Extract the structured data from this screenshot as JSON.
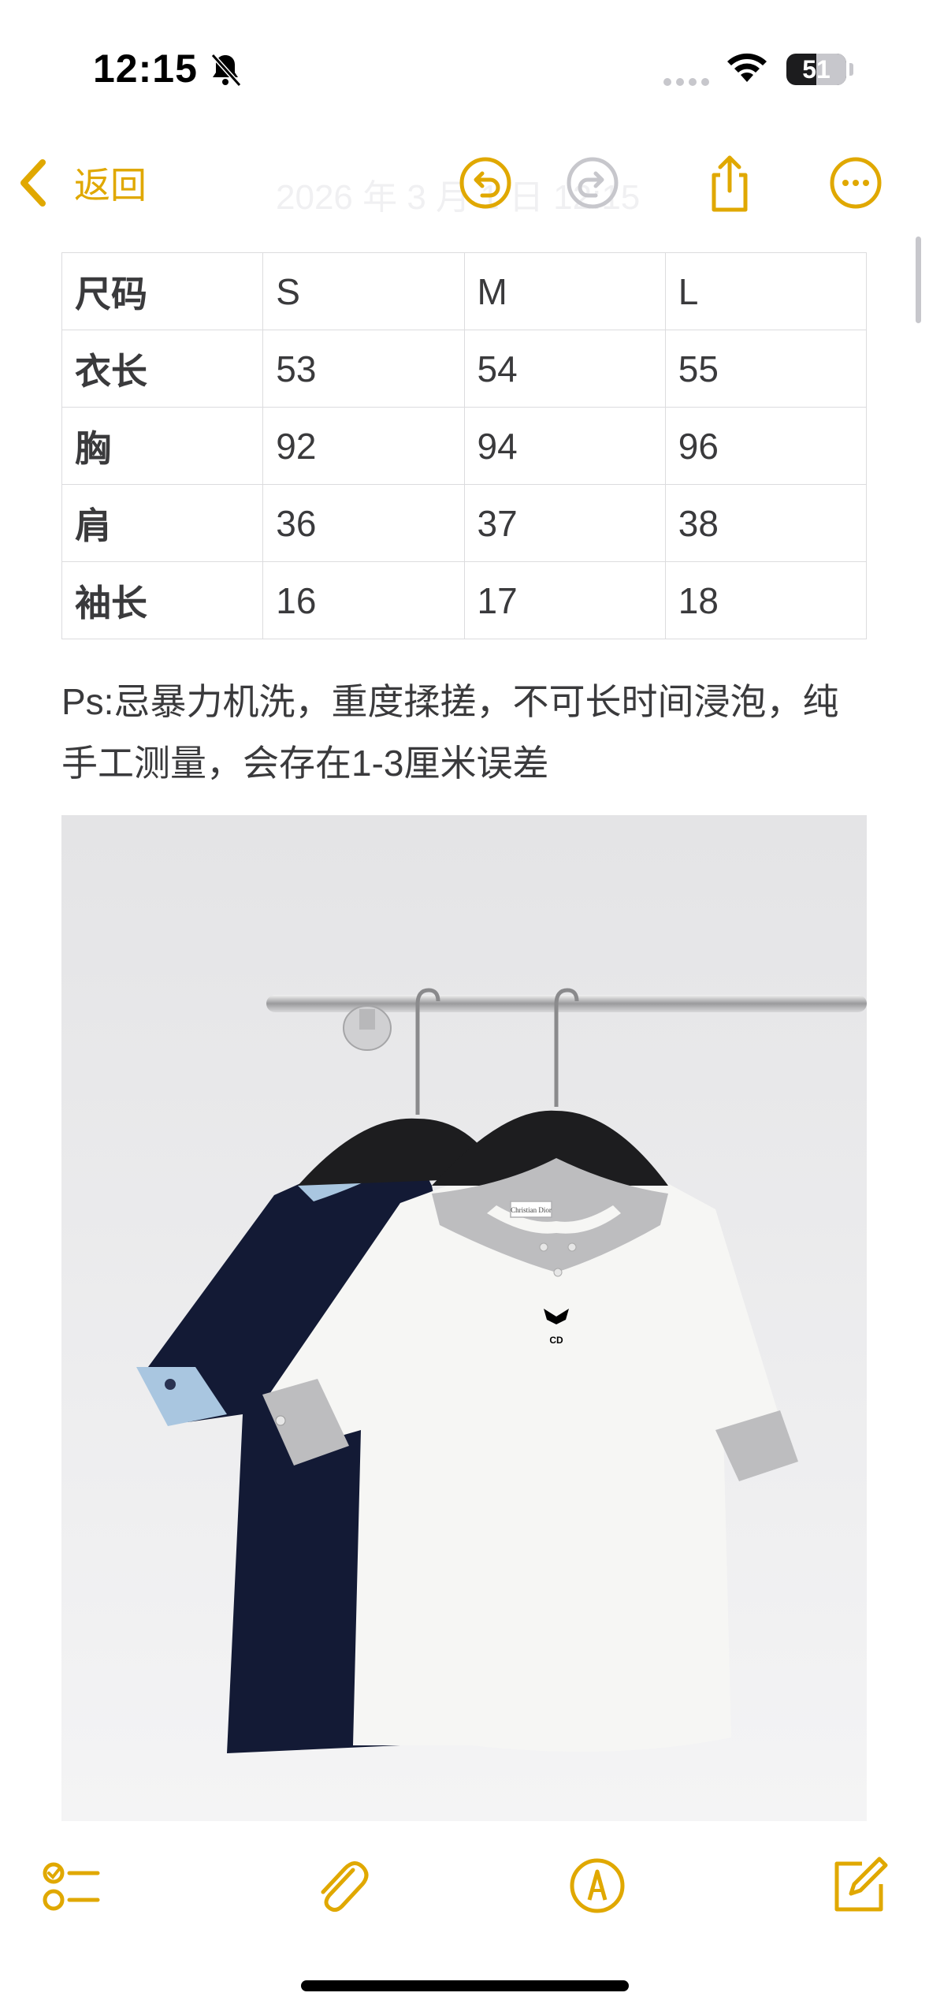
{
  "status_bar": {
    "time": "12:15",
    "battery_level": "51",
    "icons": [
      "bell-slash-icon",
      "signal-dots-icon",
      "wifi-icon",
      "battery-icon"
    ]
  },
  "nav": {
    "back_label": "返回",
    "title": "2026 年 3 月 1 日 12:15",
    "icons": [
      "undo-icon",
      "redo-icon",
      "share-icon",
      "more-icon"
    ]
  },
  "size_table": {
    "header": [
      "尺码",
      "S",
      "M",
      "L"
    ],
    "rows": [
      [
        "衣长",
        "53",
        "54",
        "55"
      ],
      [
        "胸",
        "92",
        "94",
        "96"
      ],
      [
        "肩",
        "36",
        "37",
        "38"
      ],
      [
        "袖长",
        "16",
        "17",
        "18"
      ]
    ]
  },
  "note_text": "Ps:忌暴力机洗，重度揉搓，不可长时间浸泡，纯手工测量，会存在1-3厘米误差",
  "photo": {
    "label_brand": "Christian Dior",
    "tshirt_print": "CD"
  },
  "toolbar": {
    "icons": [
      "checklist-icon",
      "paperclip-icon",
      "markup-pen-icon",
      "compose-icon"
    ]
  },
  "colors": {
    "accent": "#E0A800",
    "text": "#3A3A3C",
    "table_border": "#DCDCDE",
    "navy_tshirt": "#131a35",
    "light_blue_trim": "#a9c6e0",
    "grey_trim": "#bdbdbf"
  }
}
